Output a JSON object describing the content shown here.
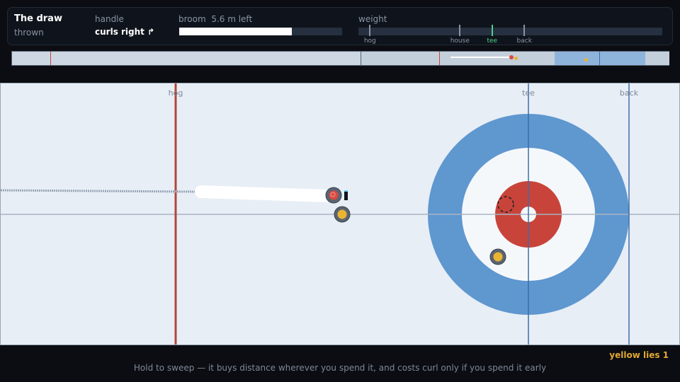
{
  "hud": {
    "title": "The draw",
    "handle_label": "handle",
    "handle_value": "curls right ↱",
    "thrown_label": "thrown",
    "broom_label": "broom",
    "broom_value": "5.6 m left",
    "broom_fraction": 0.69,
    "weight_label": "weight",
    "weight_ticks": [
      {
        "label": "hog",
        "frac": 0.038,
        "highlight": false
      },
      {
        "label": "house",
        "frac": 0.334,
        "highlight": false
      },
      {
        "label": "tee",
        "frac": 0.44,
        "highlight": true
      },
      {
        "label": "back",
        "frac": 0.546,
        "highlight": false
      }
    ]
  },
  "sheet": {
    "line_labels": {
      "hog": "hog",
      "tee": "tee",
      "back": "back"
    }
  },
  "status": "yellow lies 1",
  "hint": "Hold to sweep — it buys distance wherever you spend it, and costs curl only if you spend it early",
  "colors": {
    "ice": "#e7eef6",
    "house_blue": "#5f97cf",
    "house_white": "#f5f8fb",
    "button_red": "#c8443a",
    "hog_line": "#b5443a",
    "stone_red": "#d94a40",
    "stone_yellow": "#e9b431",
    "accent_green": "#4fd08a",
    "accent_yellow": "#e3a832"
  },
  "icons": [
    "red-stone-icon",
    "yellow-stone-icon",
    "broom-target-icon",
    "sweep-trail"
  ]
}
